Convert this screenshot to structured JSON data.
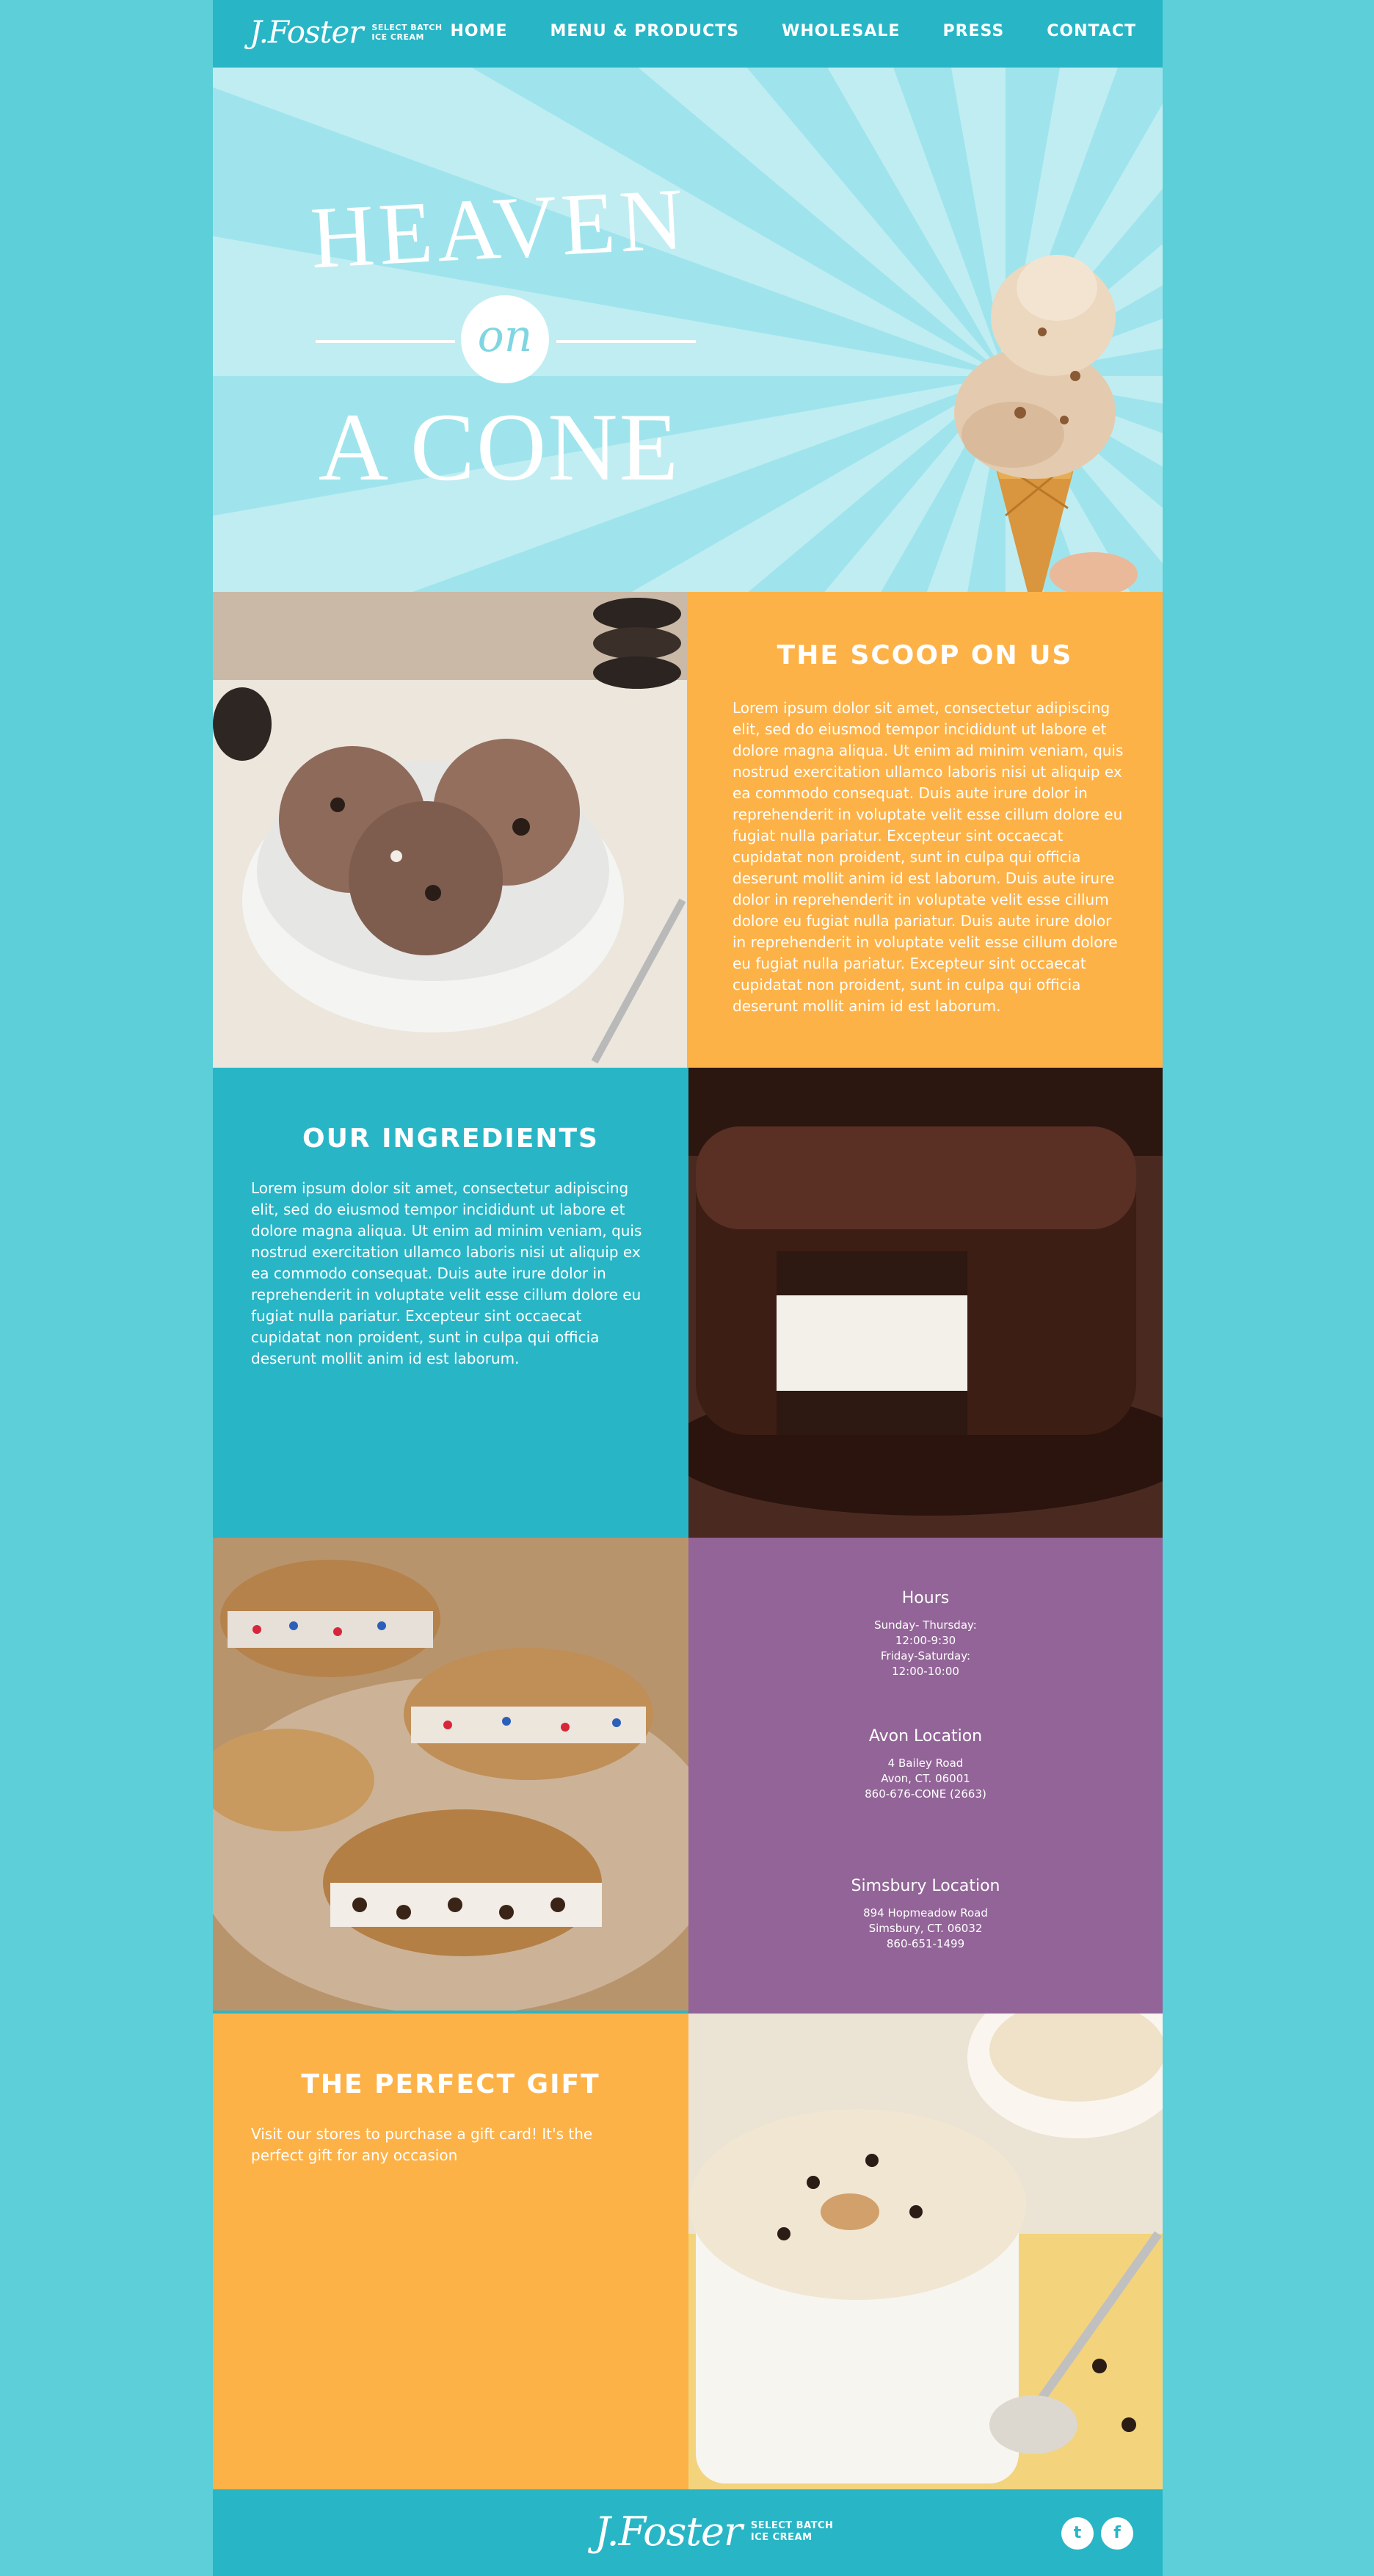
{
  "brand": {
    "logo_script": "J.Foster",
    "logo_sub_line1": "SELECT BATCH",
    "logo_sub_line2": "ICE CREAM"
  },
  "nav": {
    "items": [
      {
        "label": "HOME"
      },
      {
        "label": "MENU & PRODUCTS"
      },
      {
        "label": "WHOLESALE"
      },
      {
        "label": "PRESS"
      },
      {
        "label": "CONTACT"
      }
    ]
  },
  "hero": {
    "line1": "HEAVEN",
    "line2": "on",
    "line3": "A CONE"
  },
  "scoop": {
    "title": "THE SCOOP ON US",
    "body": "Lorem ipsum dolor sit amet, consectetur adipiscing elit, sed do eiusmod tempor incididunt ut labore et dolore magna aliqua. Ut enim ad minim veniam, quis nostrud exercitation ullamco laboris nisi ut aliquip ex ea commodo consequat. Duis aute irure dolor in reprehenderit in voluptate velit esse cillum dolore eu fugiat nulla pariatur. Excepteur sint occaecat cupidatat non proident, sunt in culpa qui officia deserunt mollit anim id est laborum. Duis aute irure dolor in reprehenderit in voluptate velit esse cillum dolore eu fugiat nulla pariatur. Duis aute irure dolor in reprehenderit in voluptate velit esse cillum dolore eu fugiat nulla pariatur. Excepteur sint occaecat cupidatat non proident, sunt in culpa qui officia deserunt mollit anim id est laborum."
  },
  "ingredients": {
    "title": "OUR INGREDIENTS",
    "body": "Lorem ipsum dolor sit amet, consectetur adipiscing elit, sed do eiusmod tempor incididunt ut labore et dolore magna aliqua. Ut enim ad minim veniam, quis nostrud exercitation ullamco laboris nisi ut aliquip ex ea commodo consequat. Duis aute irure dolor in reprehenderit in voluptate velit esse cillum dolore eu fugiat nulla pariatur. Excepteur sint occaecat cupidatat non proident, sunt in culpa qui officia deserunt mollit anim id est laborum."
  },
  "info": {
    "hours_title": "Hours",
    "hours_lines": [
      "Sunday- Thursday:",
      "12:00-9:30",
      "Friday-Saturday:",
      "12:00-10:00"
    ],
    "avon_title": "Avon Location",
    "avon_lines": [
      "4 Bailey Road",
      "Avon, CT. 06001",
      "860-676-CONE  (2663)"
    ],
    "simsbury_title": "Simsbury Location",
    "simsbury_lines": [
      "894 Hopmeadow Road",
      "Simsbury, CT. 06032",
      "860-651-1499"
    ]
  },
  "gift": {
    "title": "THE PERFECT GIFT",
    "body": "Visit our stores to purchase a gift card! It's the perfect gift for any occasion"
  },
  "footer": {
    "twitter_glyph": "t",
    "facebook_glyph": "f"
  },
  "colors": {
    "background": "#5ccfd9",
    "teal": "#28b6c7",
    "orange": "#fdb248",
    "purple": "#926497",
    "hero": "#9fe4ec"
  }
}
